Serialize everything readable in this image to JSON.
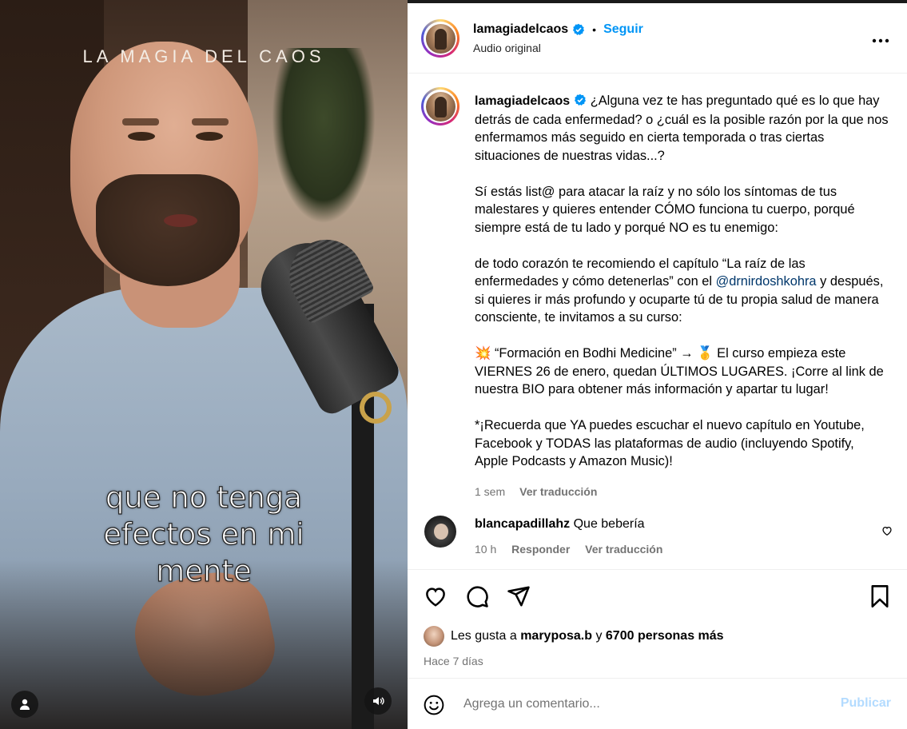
{
  "video": {
    "brand_text": "LA MAGIA DEL CAOS",
    "caption_lines": [
      "que no tenga",
      "efectos en mi",
      "mente"
    ]
  },
  "post": {
    "username": "lamagiadelcaos",
    "dot": "•",
    "follow_label": "Seguir",
    "audio_label": "Audio original",
    "more_label": "···"
  },
  "caption": {
    "username": "lamagiadelcaos",
    "p1": "¿Alguna vez te has preguntado qué es lo que hay detrás de cada enfermedad? o ¿cuál es la posible razón por la que nos enfermamos más seguido en cierta temporada o tras ciertas situaciones de nuestras vidas...?",
    "p2": "Sí estás list@ para atacar la raíz y no sólo los síntomas de tus malestares y quieres entender CÓMO funciona tu cuerpo, porqué siempre está de tu lado y porqué NO es tu enemigo:",
    "p3_before": "de todo corazón te recomiendo el capítulo “La raíz de las enfermedades y cómo detenerlas” con el ",
    "p3_mention": "@drnirdoshkohra",
    "p3_after": " y después, si quieres ir más profundo y ocuparte tú de tu propia salud de manera consciente, te invitamos a su curso:",
    "p4": "💥 “Formación en Bodhi Medicine” → 🥇 El curso empieza este VIERNES 26 de enero, quedan ÚLTIMOS LUGARES. ¡Corre al link de nuestra BIO para obtener más información y apartar tu lugar!",
    "p5": "*¡Recuerda que YA puedes escuchar el nuevo capítulo en Youtube, Facebook y TODAS las plataformas de audio (incluyendo Spotify, Apple Podcasts y Amazon Music)!",
    "time": "1 sem",
    "translate_label": "Ver traducción"
  },
  "comment": {
    "username": "blancapadillahz",
    "text": "Que bebería",
    "time": "10 h",
    "reply_label": "Responder",
    "translate_label": "Ver traducción"
  },
  "likes": {
    "prefix": "Les gusta a",
    "user": "maryposa.b",
    "connector": "y",
    "others": "6700 personas más"
  },
  "date_label": "Hace 7 días",
  "add_comment": {
    "placeholder": "Agrega un comentario...",
    "publish_label": "Publicar"
  },
  "colors": {
    "accent": "#0095f6",
    "publish_disabled": "#b3dbff",
    "secondary_text": "#737373",
    "mention": "#00376b"
  },
  "icons": [
    "verified-icon",
    "more-icon",
    "heart-icon",
    "comment-icon",
    "share-icon",
    "bookmark-icon",
    "emoji-icon",
    "user-icon",
    "sound-icon"
  ]
}
